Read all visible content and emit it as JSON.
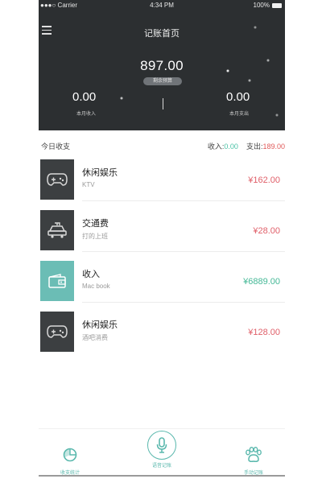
{
  "status_bar": {
    "carrier": "●●●○ Carrier",
    "time": "4:34 PM",
    "battery": "100%"
  },
  "nav": {
    "title": "记账首页"
  },
  "overview": {
    "balance": "897.00",
    "balance_badge": "剩余预算",
    "income_value": "0.00",
    "income_label": "本月收入",
    "expense_value": "0.00",
    "expense_label": "本月支出"
  },
  "summary": {
    "label": "今日收支",
    "income_label": "收入:",
    "income_value": "0.00",
    "expense_label": "支出:",
    "expense_value": "189.00"
  },
  "records": [
    {
      "category": "休闲娱乐",
      "note": "KTV",
      "amount": "¥162.00",
      "type": "expense",
      "icon": "gamepad-icon"
    },
    {
      "category": "交通费",
      "note": "打的上班",
      "amount": "¥28.00",
      "type": "expense",
      "icon": "car-icon"
    },
    {
      "category": "收入",
      "note": "Mac book",
      "amount": "¥6889.00",
      "type": "income",
      "icon": "wallet-icon"
    },
    {
      "category": "休闲娱乐",
      "note": "酒吧消费",
      "amount": "¥128.00",
      "type": "expense",
      "icon": "gamepad-icon"
    }
  ],
  "tabs": [
    {
      "label": "收支统计",
      "icon": "pie-chart-icon"
    },
    {
      "label": "语音记账",
      "icon": "microphone-icon"
    },
    {
      "label": "手动记账",
      "icon": "paw-icon"
    }
  ],
  "colors": {
    "header_bg": "#2c2f31",
    "accent": "#5ab8ad",
    "income": "#44b896",
    "expense": "#e0606a"
  }
}
